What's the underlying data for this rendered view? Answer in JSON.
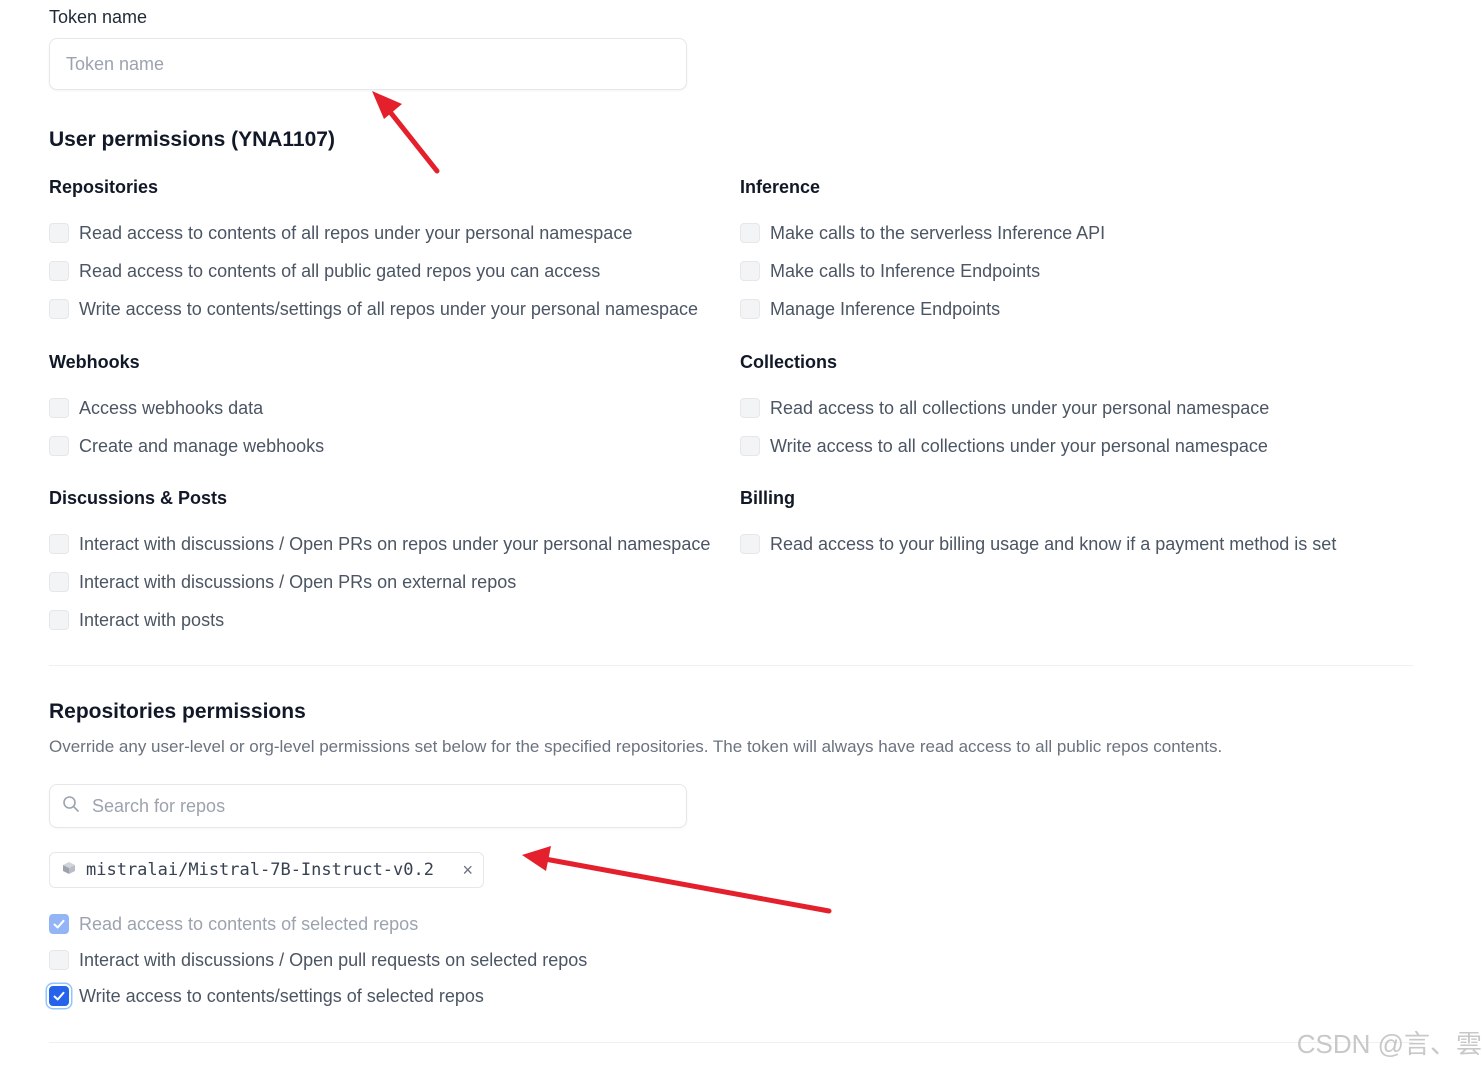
{
  "token": {
    "label": "Token name",
    "placeholder": "Token name",
    "value": ""
  },
  "user_permissions": {
    "title": "User permissions (YNA1107)",
    "repositories": {
      "title": "Repositories",
      "items": [
        {
          "label": "Read access to contents of all repos under your personal namespace",
          "checked": false
        },
        {
          "label": "Read access to contents of all public gated repos you can access",
          "checked": false
        },
        {
          "label": "Write access to contents/settings of all repos under your personal namespace",
          "checked": false
        }
      ]
    },
    "inference": {
      "title": "Inference",
      "items": [
        {
          "label": "Make calls to the serverless Inference API",
          "checked": false
        },
        {
          "label": "Make calls to Inference Endpoints",
          "checked": false
        },
        {
          "label": "Manage Inference Endpoints",
          "checked": false
        }
      ]
    },
    "webhooks": {
      "title": "Webhooks",
      "items": [
        {
          "label": "Access webhooks data",
          "checked": false
        },
        {
          "label": "Create and manage webhooks",
          "checked": false
        }
      ]
    },
    "collections": {
      "title": "Collections",
      "items": [
        {
          "label": "Read access to all collections under your personal namespace",
          "checked": false
        },
        {
          "label": "Write access to all collections under your personal namespace",
          "checked": false
        }
      ]
    },
    "discussions": {
      "title": "Discussions & Posts",
      "items": [
        {
          "label": "Interact with discussions / Open PRs on repos under your personal namespace",
          "checked": false
        },
        {
          "label": "Interact with discussions / Open PRs on external repos",
          "checked": false
        },
        {
          "label": "Interact with posts",
          "checked": false
        }
      ]
    },
    "billing": {
      "title": "Billing",
      "items": [
        {
          "label": "Read access to your billing usage and know if a payment method is set",
          "checked": false
        }
      ]
    }
  },
  "repo_permissions": {
    "title": "Repositories permissions",
    "description": "Override any user-level or org-level permissions set below for the specified repositories. The token will always have read access to all public repos contents.",
    "search_placeholder": "Search for repos",
    "selected_repo": "mistralai/Mistral-7B-Instruct-v0.2",
    "remove_symbol": "×",
    "items": [
      {
        "label": "Read access to contents of selected repos",
        "checked": true,
        "disabled": true
      },
      {
        "label": "Interact with discussions / Open pull requests on selected repos",
        "checked": false
      },
      {
        "label": "Write access to contents/settings of selected repos",
        "checked": true
      }
    ]
  },
  "watermark": "CSDN @言、雲",
  "colors": {
    "accent": "#2563eb",
    "annotation_arrow": "#e3202b"
  },
  "icons": [
    "search-icon",
    "repo-cube-icon",
    "close-icon",
    "checkmark-icon",
    "annotation-arrow"
  ]
}
